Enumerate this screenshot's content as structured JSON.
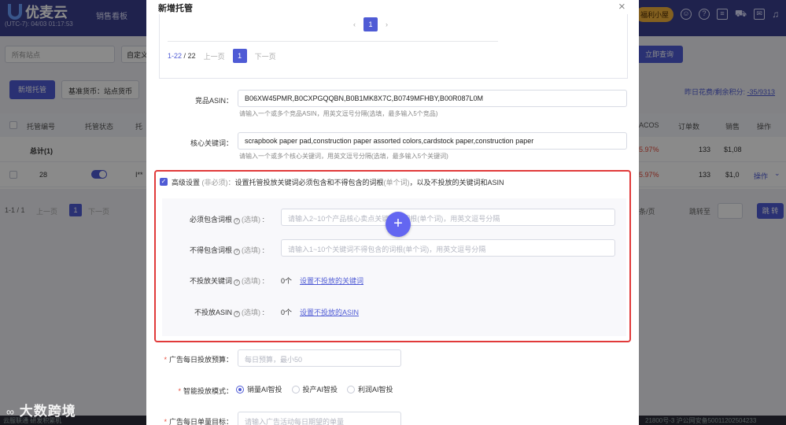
{
  "app": {
    "logo": "优麦云",
    "timezone": "(UTC-7): 04/03 01:17:53",
    "nav_item": "销售看板",
    "promo": "福利小屋"
  },
  "filters": {
    "site_placeholder": "所有站点",
    "custom_label": "自定义",
    "query_button": "立即查询"
  },
  "actions": {
    "new_button": "新增托管",
    "currency_button": "基准货币：站点货币",
    "spend_text": "昨日花费/剩余积分:",
    "spend_value": "-35/9313"
  },
  "table": {
    "columns": [
      "托管编号",
      "托管状态",
      "托",
      "ACOS",
      "订单数",
      "销售",
      "操作"
    ],
    "total_label": "总计(1)",
    "total_acos": "5.97%",
    "total_orders": "133",
    "total_sales": "$1,08",
    "row_id": "28",
    "row_name": "I**",
    "row_acos": "5.97%",
    "row_orders": "133",
    "row_sales": "$1,0",
    "row_action": "操作"
  },
  "pager": {
    "range": "1-1 / 1",
    "prev": "上一页",
    "page": "1",
    "next": "下一页",
    "per_page": "条/页",
    "jump_label": "跳转至",
    "jump_button": "跳 转"
  },
  "footer": {
    "left": "云服联通 研发积累机",
    "right": "21800号-3   沪公网安备50011202504233"
  },
  "watermark": "大数跨境",
  "modal": {
    "title": "新增托管",
    "close": "×",
    "pagination": {
      "top_page": "1",
      "range_start": "1-22",
      "total": "22",
      "prev": "上一页",
      "page": "1",
      "next": "下一页"
    },
    "competitor_asin": {
      "label": "竞品ASIN：",
      "value": "B06XW45PMR,B0CXPGQQBN,B0B1MK8X7C,B0749MFHBY,B00R087L0M",
      "hint": "请输入一个或多个竞品ASIN，用英文逗号分隔(选填，最多输入5个竞品)"
    },
    "core_keywords": {
      "label": "核心关键词：",
      "value": "scrapbook paper pad,construction paper assorted colors,cardstock paper,construction paper",
      "hint": "请输入一个或多个核心关键词，用英文逗号分隔(选填，最多输入5个关键词)"
    },
    "advanced": {
      "title": "高级设置",
      "optional": "(非必须)：",
      "desc_a": "设置托管投放关键词必须包含和不得包含的词根",
      "desc_b": "(单个词)",
      "desc_c": "，以及不投放的关键词和ASIN",
      "must_include": {
        "label": "必须包含词根",
        "optional": "(选填)",
        "placeholder": "请输入2~10个产品核心卖点关键词的词根(单个词)，用英文逗号分隔"
      },
      "must_exclude": {
        "label": "不得包含词根",
        "optional": "(选填)",
        "placeholder": "请输入1~10个关键词不得包含的词根(单个词)，用英文逗号分隔"
      },
      "neg_keywords": {
        "label": "不投放关键词",
        "optional": "(选填)",
        "count": "0个",
        "link": "设置不投放的关键词"
      },
      "neg_asin": {
        "label": "不投放ASIN",
        "optional": "(选填)",
        "count": "0个",
        "link": "设置不投放的ASIN"
      }
    },
    "daily_budget": {
      "label": "广告每日投放预算：",
      "placeholder": "每日预算，最小50"
    },
    "mode": {
      "label": "智能投放模式：",
      "options": [
        "销量AI智投",
        "投产AI智投",
        "利润AI智投"
      ],
      "selected": 0
    },
    "daily_orders": {
      "label": "广告每日单量目标：",
      "placeholder": "请输入广告活动每日期望的单量"
    }
  }
}
